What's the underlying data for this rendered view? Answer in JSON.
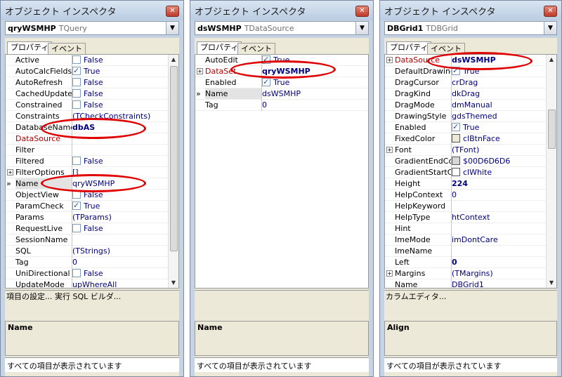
{
  "title": "オブジェクト インスペクタ",
  "props_tab": "プロパティ",
  "events_tab": "イベント",
  "status": "すべての項目が表示されています",
  "panels": [
    {
      "component_name": "qryWSMHP",
      "component_type": "TQuery",
      "rows": [
        {
          "name": "Active",
          "value": "False",
          "check": false
        },
        {
          "name": "AutoCalcFields",
          "value": "True",
          "check": true
        },
        {
          "name": "AutoRefresh",
          "value": "False",
          "check": false
        },
        {
          "name": "CachedUpdates",
          "value": "False",
          "check": false
        },
        {
          "name": "Constrained",
          "value": "False",
          "check": false
        },
        {
          "name": "Constraints",
          "value": "(TCheckConstraints)"
        },
        {
          "name": "DatabaseName",
          "value": "dbAS",
          "bold": true
        },
        {
          "name": "DataSource",
          "value": "",
          "event": true
        },
        {
          "name": "Filter",
          "value": ""
        },
        {
          "name": "Filtered",
          "value": "False",
          "check": false
        },
        {
          "name": "FilterOptions",
          "value": "[]",
          "expand": true
        },
        {
          "name": "Name",
          "value": "qryWSMHP",
          "selected": true
        },
        {
          "name": "ObjectView",
          "value": "False",
          "check": false
        },
        {
          "name": "ParamCheck",
          "value": "True",
          "check": true
        },
        {
          "name": "Params",
          "value": "(TParams)"
        },
        {
          "name": "RequestLive",
          "value": "False",
          "check": false
        },
        {
          "name": "SessionName",
          "value": ""
        },
        {
          "name": "SQL",
          "value": "(TStrings)"
        },
        {
          "name": "Tag",
          "value": "0"
        },
        {
          "name": "UniDirectional",
          "value": "False",
          "check": false
        },
        {
          "name": "UpdateMode",
          "value": "upWhereAll"
        }
      ],
      "desc_line": "項目の設定... 実行 SQL ビルダ...",
      "desc_title": "Name"
    },
    {
      "component_name": "dsWSMHP",
      "component_type": "TDataSource",
      "rows": [
        {
          "name": "AutoEdit",
          "value": "True",
          "check": true
        },
        {
          "name": "DataSet",
          "value": "qryWSMHP",
          "bold": true,
          "event": true,
          "expand": true
        },
        {
          "name": "Enabled",
          "value": "True",
          "check": true
        },
        {
          "name": "Name",
          "value": "dsWSMHP",
          "selected": true
        },
        {
          "name": "Tag",
          "value": "0"
        }
      ],
      "desc_line": "",
      "desc_title": "Name"
    },
    {
      "component_name": "DBGrid1",
      "component_type": "TDBGrid",
      "rows": [
        {
          "name": "DataSource",
          "value": "dsWSMHP",
          "bold": true,
          "event": true,
          "expand": true
        },
        {
          "name": "DefaultDrawing",
          "value": "True",
          "check": true
        },
        {
          "name": "DragCursor",
          "value": "crDrag"
        },
        {
          "name": "DragKind",
          "value": "dkDrag"
        },
        {
          "name": "DragMode",
          "value": "dmManual"
        },
        {
          "name": "DrawingStyle",
          "value": "gdsThemed"
        },
        {
          "name": "Enabled",
          "value": "True",
          "check": true
        },
        {
          "name": "FixedColor",
          "value": "clBtnFace",
          "swatch": "#ece9d8"
        },
        {
          "name": "Font",
          "value": "(TFont)",
          "expand": true
        },
        {
          "name": "GradientEndColor",
          "value": "$00D6D6D6",
          "swatch": "#d6d6d6"
        },
        {
          "name": "GradientStartColor",
          "value": "clWhite",
          "swatch": "#ffffff"
        },
        {
          "name": "Height",
          "value": "224",
          "bold": true
        },
        {
          "name": "HelpContext",
          "value": "0"
        },
        {
          "name": "HelpKeyword",
          "value": ""
        },
        {
          "name": "HelpType",
          "value": "htContext"
        },
        {
          "name": "Hint",
          "value": ""
        },
        {
          "name": "ImeMode",
          "value": "imDontCare"
        },
        {
          "name": "ImeName",
          "value": ""
        },
        {
          "name": "Left",
          "value": "0",
          "bold": true
        },
        {
          "name": "Margins",
          "value": "(TMargins)",
          "expand": true
        },
        {
          "name": "Name",
          "value": "DBGrid1"
        }
      ],
      "desc_line": "カラムエディタ...",
      "desc_title": "Align"
    }
  ]
}
